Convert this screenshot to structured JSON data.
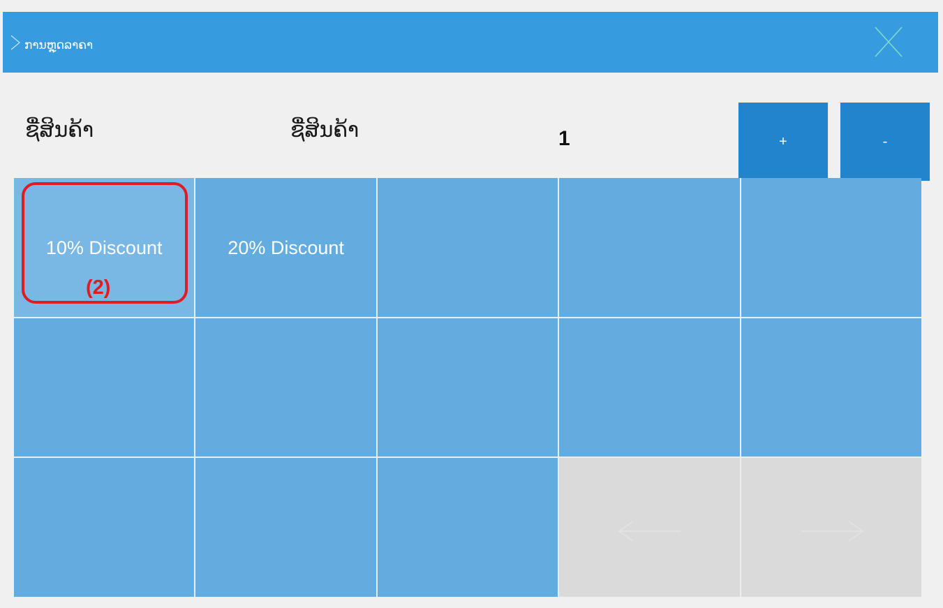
{
  "dialog": {
    "title": "ການຫຼຸດລາຄາ",
    "close_icon": "close-icon",
    "chevron_icon": "chevron-right-icon"
  },
  "header": {
    "label_left": "ຊື່ສິນຄ້າ",
    "label_middle": "ຊື່ສິນຄ້າ",
    "quantity": "1",
    "plus_label": "+",
    "minus_label": "-"
  },
  "grid": {
    "cells": [
      "10% Discount",
      "20% Discount",
      "",
      "",
      "",
      "",
      "",
      "",
      "",
      "",
      "",
      "",
      ""
    ],
    "prev_icon": "arrow-left-icon",
    "next_icon": "arrow-right-icon"
  },
  "annotation": {
    "badge": "(2)"
  },
  "colors": {
    "titlebar": "#379be0",
    "button": "#2184cc",
    "cell": "#62acdf",
    "nav_cell": "#dadada",
    "highlight": "#e01b24"
  }
}
